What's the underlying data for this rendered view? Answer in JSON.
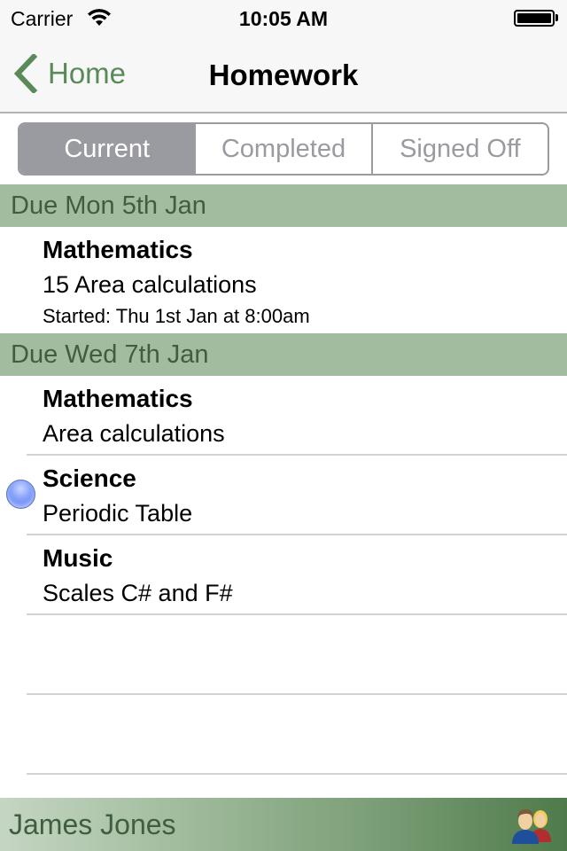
{
  "status_bar": {
    "carrier": "Carrier",
    "time": "10:05 AM",
    "wifi_icon": "wifi-icon",
    "battery_icon": "battery-full-icon"
  },
  "nav": {
    "back_label": "Home",
    "back_icon": "chevron-left-icon",
    "title": "Homework"
  },
  "segments": [
    {
      "label": "Current",
      "selected": true
    },
    {
      "label": "Completed",
      "selected": false
    },
    {
      "label": "Signed Off",
      "selected": false
    }
  ],
  "sections": [
    {
      "header": "Due Mon 5th Jan",
      "items": [
        {
          "subject": "Mathematics",
          "description": "15 Area calculations",
          "started": "Started: Thu 1st Jan at 8:00am"
        }
      ]
    },
    {
      "header": "Due Wed 7th Jan",
      "items": [
        {
          "subject": "Mathematics",
          "description": "Area calculations"
        },
        {
          "subject": "Science",
          "description": "Periodic Table",
          "unread_indicator": "blue-dot-icon"
        },
        {
          "subject": "Music",
          "description": "Scales C# and F#"
        }
      ]
    }
  ],
  "footer": {
    "student_name": "James Jones",
    "switch_user_icon": "users-icon"
  },
  "colors": {
    "accent_green": "#5b8a5a",
    "section_header_bg": "#a2bc9f",
    "section_header_text": "#3f5e3e",
    "segment_gray": "#9a9ba0",
    "unread_blue": "#6a8cf5"
  }
}
